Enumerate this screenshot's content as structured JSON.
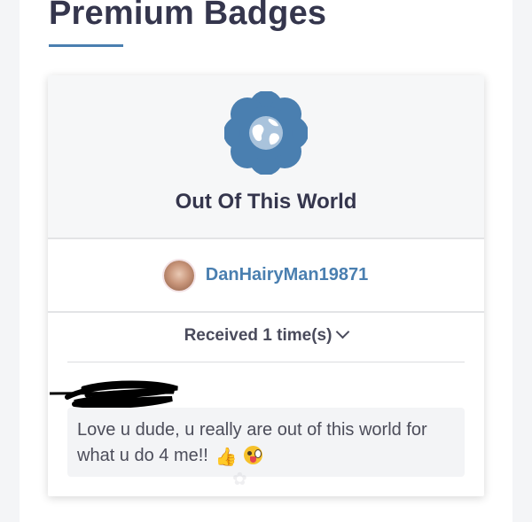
{
  "section": {
    "title": "Premium Badges"
  },
  "badge": {
    "icon": "globe-flower-icon",
    "name": "Out Of This World",
    "icon_color": "#4a7fb0"
  },
  "owner": {
    "username": "DanHairyMan19871"
  },
  "received": {
    "label": "Received 1 time(s)",
    "icon": "chevron-down-icon"
  },
  "message": {
    "text": "Love u dude, u really are out of this world for what u do 4 me!!",
    "emojis": [
      "thumbs-up-icon",
      "winking-tongue-face-icon"
    ]
  },
  "colors": {
    "accent": "#4a7fb0",
    "heading": "#35364d"
  }
}
